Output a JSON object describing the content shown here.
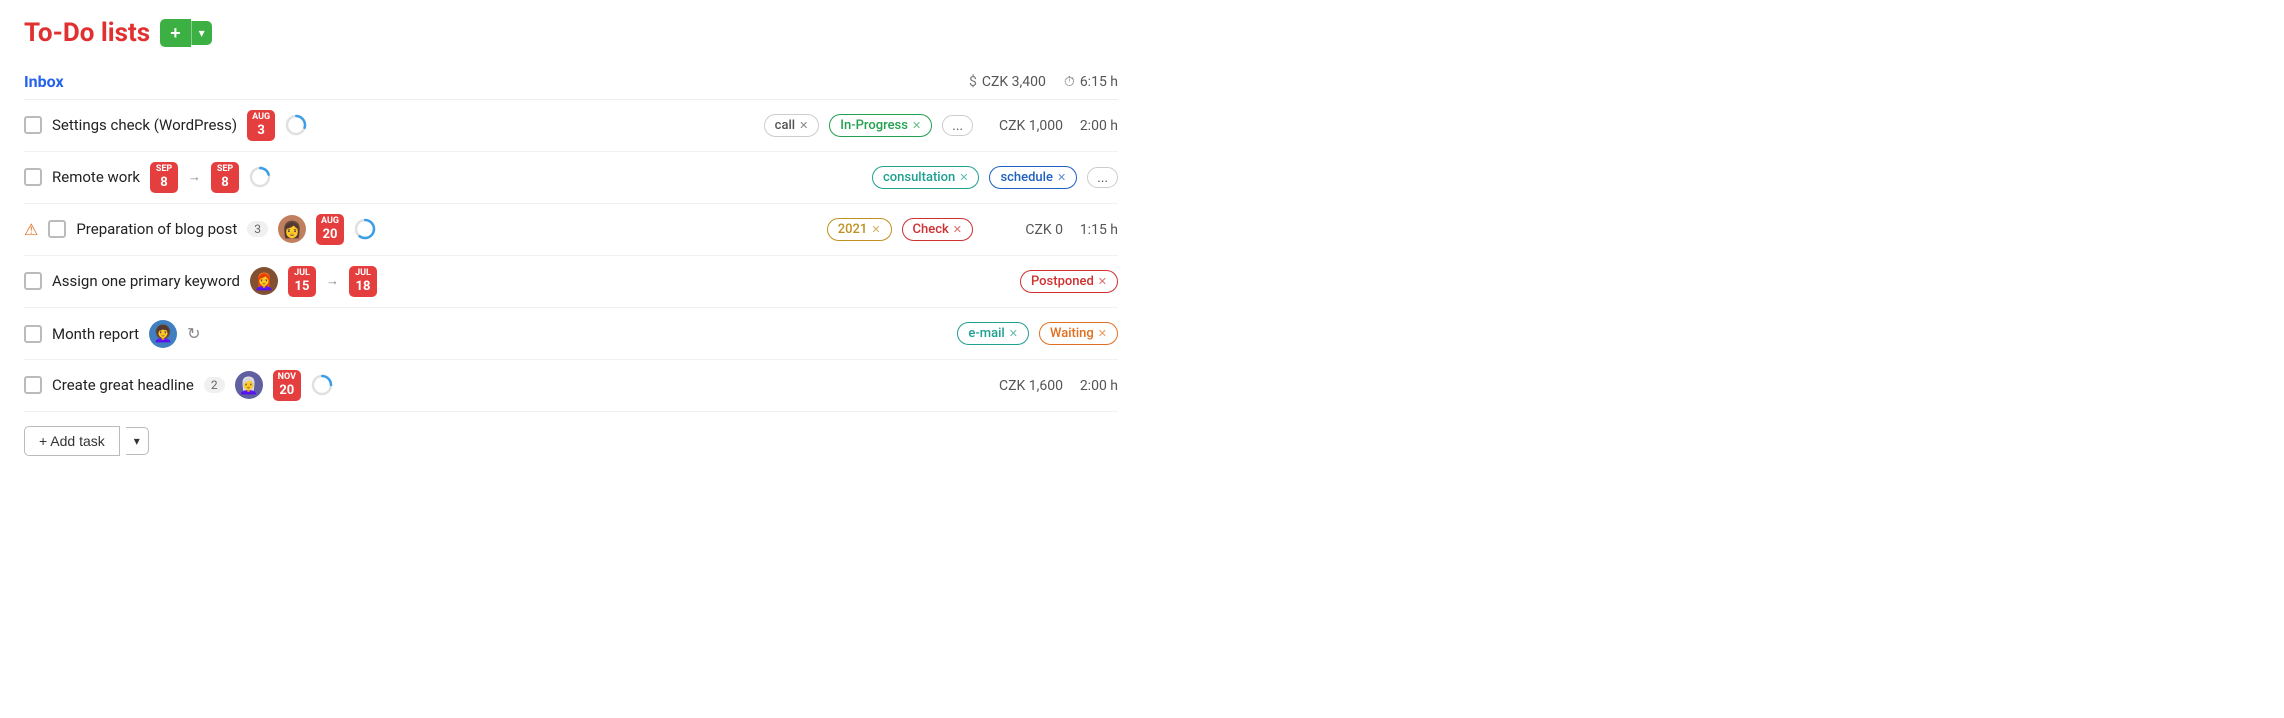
{
  "page": {
    "title": "To-Do lists",
    "add_btn_label": "+",
    "dropdown_btn_label": "▾"
  },
  "inbox": {
    "title": "Inbox",
    "total_czk": "CZK 3,400",
    "total_time": "6:15 h"
  },
  "tasks": [
    {
      "id": 1,
      "name": "Settings check (WordPress)",
      "date1": {
        "month": "Aug",
        "day": "3"
      },
      "has_arrow": false,
      "date2": null,
      "has_progress": true,
      "progress_pct": 30,
      "avatar": null,
      "count": null,
      "warning": false,
      "badges": [
        {
          "label": "call",
          "type": "gray"
        },
        {
          "label": "In-Progress",
          "type": "green"
        }
      ],
      "more": true,
      "czk": "CZK 1,000",
      "time": "2:00 h"
    },
    {
      "id": 2,
      "name": "Remote work",
      "date1": {
        "month": "Sep",
        "day": "8"
      },
      "has_arrow": true,
      "date2": {
        "month": "Sep",
        "day": "8"
      },
      "has_progress": true,
      "progress_pct": 20,
      "avatar": null,
      "count": null,
      "warning": false,
      "badges": [
        {
          "label": "consultation",
          "type": "teal"
        },
        {
          "label": "schedule",
          "type": "blue"
        }
      ],
      "more": true,
      "czk": null,
      "time": null
    },
    {
      "id": 3,
      "name": "Preparation of blog post",
      "date1": {
        "month": "Aug",
        "day": "20"
      },
      "has_arrow": false,
      "date2": null,
      "has_progress": true,
      "progress_pct": 60,
      "avatar": "1",
      "count": "3",
      "warning": true,
      "badges": [
        {
          "label": "2021",
          "type": "yellow"
        },
        {
          "label": "Check",
          "type": "red"
        }
      ],
      "more": false,
      "czk": "CZK 0",
      "time": "1:15 h"
    },
    {
      "id": 4,
      "name": "Assign one primary keyword",
      "date1": {
        "month": "Jul",
        "day": "15"
      },
      "has_arrow": true,
      "date2": {
        "month": "Jul",
        "day": "18"
      },
      "has_progress": false,
      "avatar": "3",
      "count": null,
      "warning": false,
      "badges": [
        {
          "label": "Postponed",
          "type": "red"
        }
      ],
      "more": false,
      "czk": null,
      "time": null
    },
    {
      "id": 5,
      "name": "Month report",
      "date1": null,
      "has_arrow": false,
      "date2": null,
      "has_progress": false,
      "has_refresh": true,
      "avatar": "2",
      "count": null,
      "warning": false,
      "badges": [
        {
          "label": "e-mail",
          "type": "teal"
        },
        {
          "label": "Waiting",
          "type": "orange"
        }
      ],
      "more": false,
      "czk": null,
      "time": null
    },
    {
      "id": 6,
      "name": "Create great headline",
      "date1": {
        "month": "Nov",
        "day": "20"
      },
      "has_arrow": false,
      "date2": null,
      "has_progress": true,
      "progress_pct": 25,
      "avatar": "4",
      "count": "2",
      "warning": false,
      "badges": [],
      "more": false,
      "czk": "CZK 1,600",
      "time": "2:00 h"
    }
  ],
  "add_task": {
    "label": "+ Add task",
    "dropdown": "▾"
  }
}
